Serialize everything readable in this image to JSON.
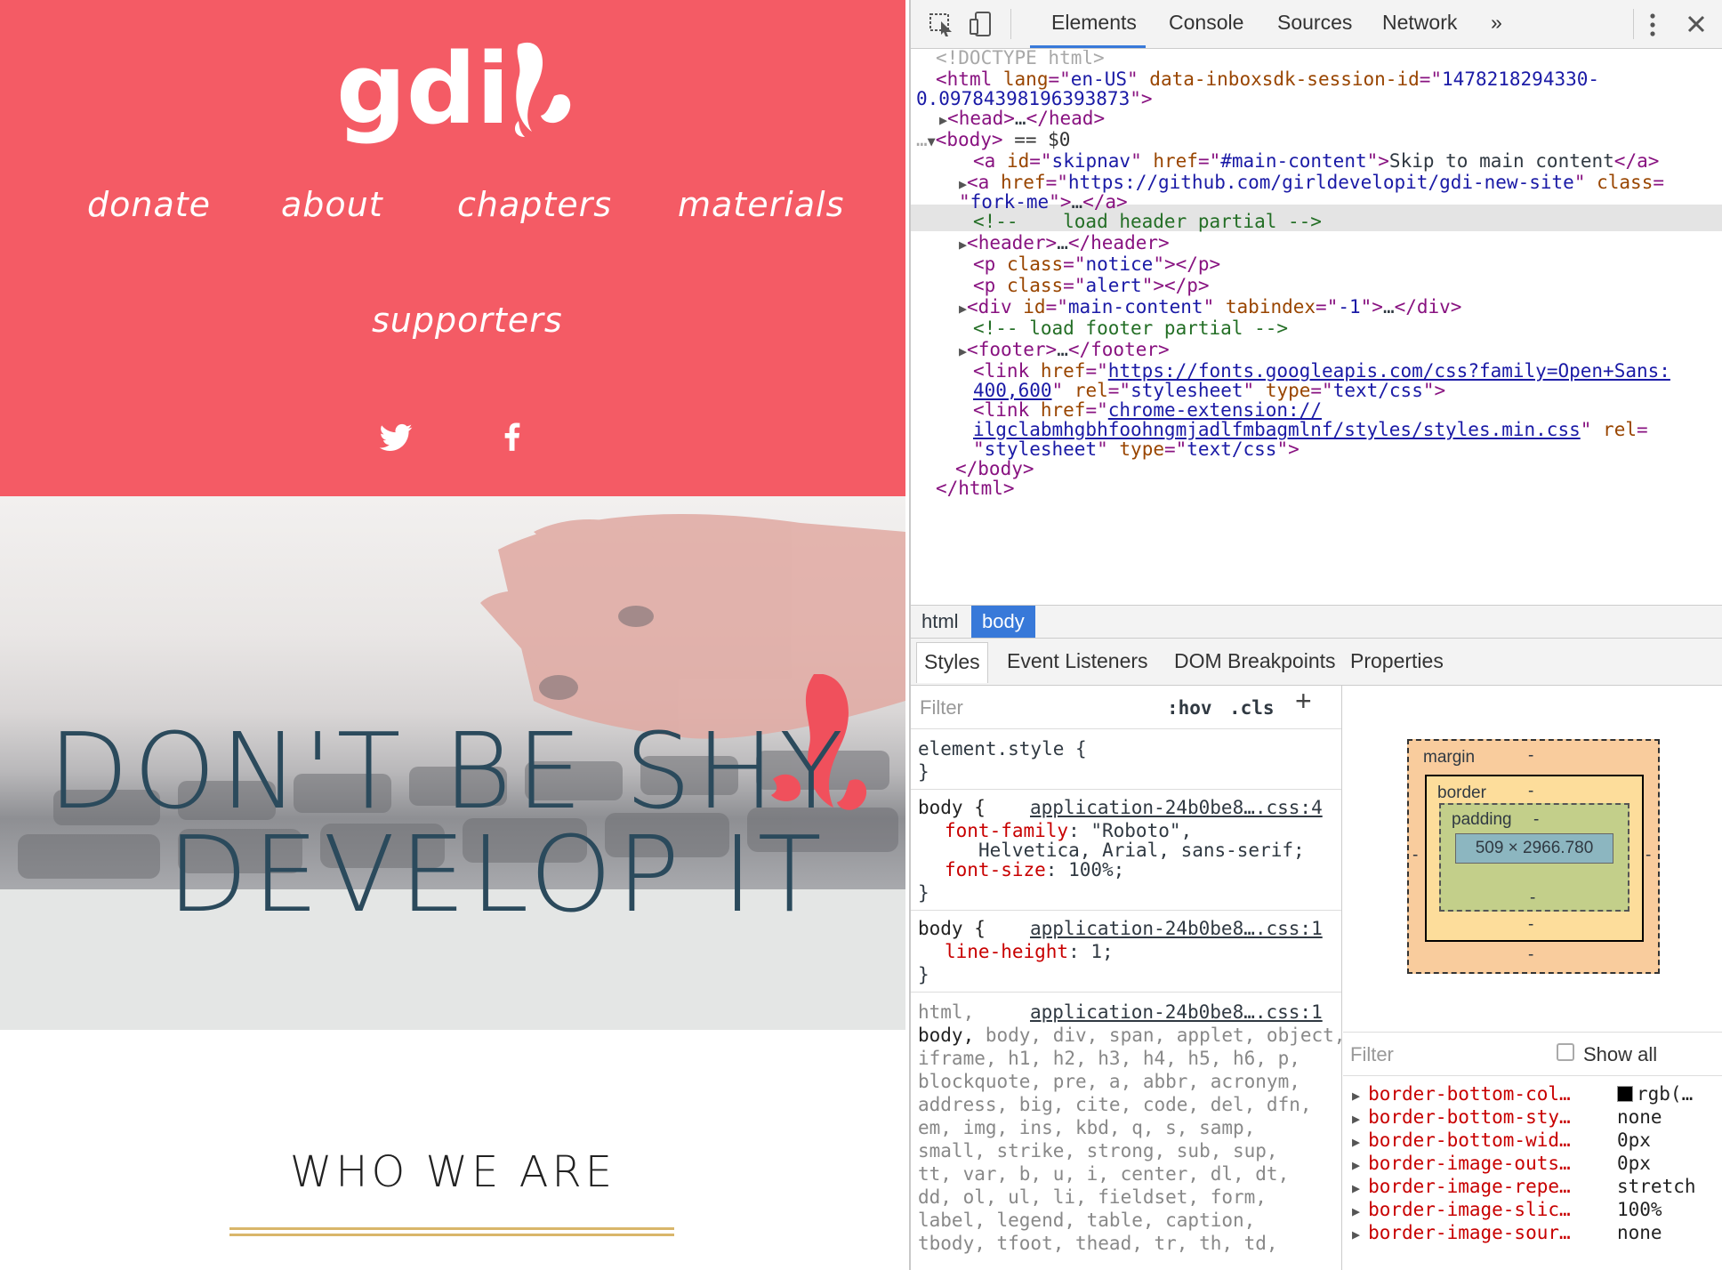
{
  "site": {
    "logo_text": "gdi",
    "nav": [
      "donate",
      "about",
      "chapters",
      "materials",
      "supporters"
    ],
    "social": [
      "twitter-icon",
      "facebook-icon"
    ],
    "hero_line1": "DON'T BE SHY",
    "hero_line2": "DEVELOP IT",
    "section_title": "WHO WE ARE",
    "colors": {
      "header_bg": "#f45b65",
      "hero_text": "#2b4a5c",
      "rule": "#d9b66a"
    }
  },
  "devtools": {
    "tabs": [
      "Elements",
      "Console",
      "Sources",
      "Network",
      "»"
    ],
    "dom": {
      "doctype": "<!DOCTYPE html>",
      "html_open_tag": "html",
      "html_lang_attr": "lang",
      "html_lang_val": "en-US",
      "html_sess_attr": "data-inboxsdk-session-id",
      "html_sess_val_1": "1478218294330-",
      "html_sess_val_2": "0.09784398196393873",
      "head_line": "head",
      "head_close": "/head",
      "body_tag": "body",
      "body_suffix": " == $0",
      "skip_attr_id": "id",
      "skip_val_id": "skipnav",
      "skip_attr_href": "href",
      "skip_val_href": "#main-content",
      "skip_text": "Skip to main content",
      "fork_href": "https://github.com/girldevelopit/gdi-new-site",
      "fork_class_attr": "class",
      "fork_class_val": "fork-me",
      "comment_header": "<!--    load header partial -->",
      "header_tag": "header",
      "notice_class": "notice",
      "alert_class": "alert",
      "main_id": "main-content",
      "main_tabindex": "-1",
      "comment_footer": "<!-- load footer partial -->",
      "footer_tag": "footer",
      "link1_href_1": "https://fonts.googleapis.com/css?family=Open+Sans:",
      "link1_href_2": "400,600",
      "rel_val": "stylesheet",
      "type_val": "text/css",
      "link2_href_1": "chrome-extension://",
      "link2_href_2": "ilgclabmhgbhfoohngmjadlfmbagmlnf/styles/styles.min.css",
      "body_close": "</body>",
      "html_close": "</html>"
    },
    "breadcrumbs": [
      "html",
      "body"
    ],
    "sub_tabs": [
      "Styles",
      "Event Listeners",
      "DOM Breakpoints",
      "Properties"
    ],
    "styles": {
      "filter_placeholder": "Filter",
      "hov": ":hov",
      "cls": ".cls",
      "plus": "+",
      "element_style": "element.style {",
      "close_brace": "}",
      "rule1_selector": "body {",
      "rule1_source": "application-24b0be8….css:4",
      "rule1_p1_name": "font-family",
      "rule1_p1_val_1": ": \"Roboto\",",
      "rule1_p1_val_2": "Helvetica, Arial, sans-serif;",
      "rule1_p2_name": "font-size",
      "rule1_p2_val": ": 100%;",
      "rule2_selector": "body {",
      "rule2_source": "application-24b0be8….css:1",
      "rule2_p1_name": "line-height",
      "rule2_p1_val": ": 1;",
      "rule3_source": "application-24b0be8….css:1",
      "rule3_first": "html,",
      "rule3_lines": [
        "body, div, span, applet, object,",
        "iframe, h1, h2, h3, h4, h5, h6, p,",
        "blockquote, pre, a, abbr, acronym,",
        "address, big, cite, code, del, dfn,",
        "em, img, ins, kbd, q, s, samp,",
        "small, strike, strong, sub, sup,",
        "tt, var, b, u, i, center, dl, dt,",
        "dd, ol, ul, li, fieldset, form,",
        "label, legend, table, caption,",
        "tbody, tfoot, thead, tr, th, td,"
      ]
    },
    "box_model": {
      "margin_label": "margin",
      "border_label": "border",
      "padding_label": "padding",
      "dash": "-",
      "content": "509 × 2966.780"
    },
    "computed": {
      "filter_placeholder": "Filter",
      "show_all": "Show all",
      "props": [
        {
          "name": "border-bottom-col…",
          "value": "rgb(…"
        },
        {
          "name": "border-bottom-sty…",
          "value": "none"
        },
        {
          "name": "border-bottom-wid…",
          "value": "0px"
        },
        {
          "name": "border-image-outs…",
          "value": "0px"
        },
        {
          "name": "border-image-repe…",
          "value": "stretch"
        },
        {
          "name": "border-image-slic…",
          "value": "100%"
        },
        {
          "name": "border-image-sour…",
          "value": "none"
        }
      ]
    }
  }
}
